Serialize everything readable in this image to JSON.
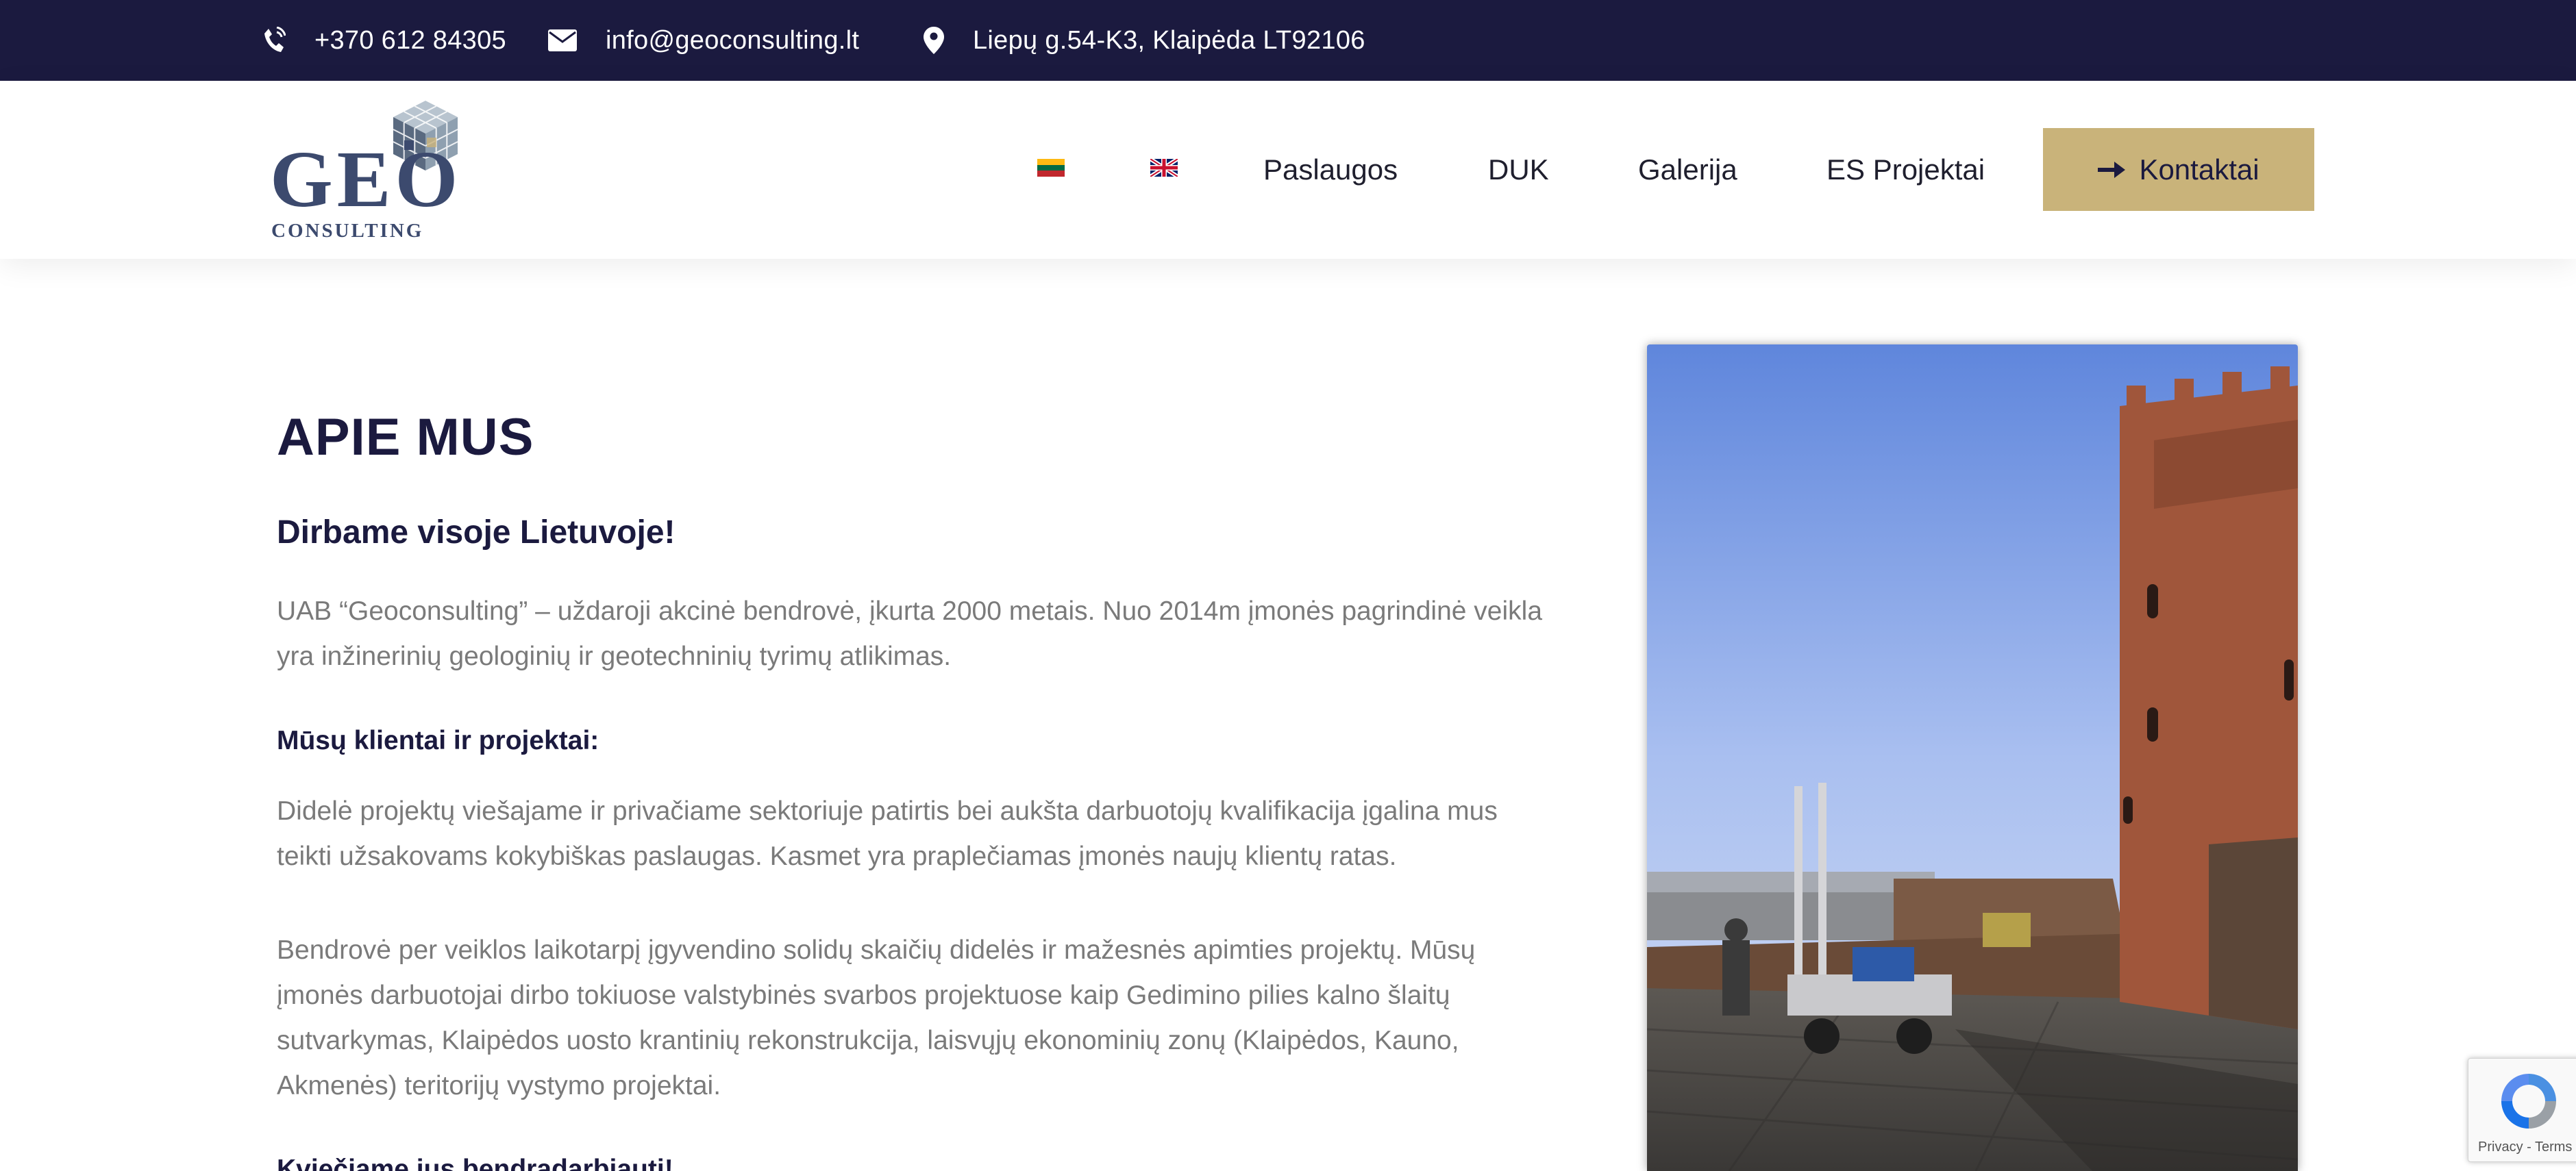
{
  "topbar": {
    "phone": "+370 612 84305",
    "email": "info@geoconsulting.lt",
    "address": "Liepų g.54-K3, Klaipėda LT92106",
    "icons": [
      "phone-icon",
      "envelope-icon",
      "map-pin-icon"
    ]
  },
  "logo": {
    "main": "GEO",
    "sub": "CONSULTING"
  },
  "nav": {
    "languages": [
      "lt-flag-icon",
      "en-flag-icon"
    ],
    "items": [
      {
        "label": "Paslaugos"
      },
      {
        "label": "DUK"
      },
      {
        "label": "Galerija"
      },
      {
        "label": "ES Projektai"
      }
    ],
    "cta_label": "Kontaktai"
  },
  "content": {
    "title": "APIE MUS",
    "subtitle": "Dirbame visoje Lietuvoje!",
    "intro": "UAB “Geoconsulting” – uždaroji akcinė bendrovė, įkurta 2000 metais. Nuo 2014m įmonės pagrindinė veikla yra inžinerinių geologinių ir geotechninių tyrimų atlikimas.",
    "clients_heading": "Mūsų klientai ir projektai:",
    "clients_text": "Didelė projektų viešajame ir privačiame sektoriuje patirtis bei aukšta darbuotojų kvalifikacija įgalina mus teikti užsakovams kokybiškas paslaugas. Kasmet yra praplečiamas įmonės naujų klientų ratas.",
    "projects_text": "Bendrovė per veiklos laikotarpį įgyvendino solidų skaičių didelės ir mažesnės apimties projektų. Mūsų įmonės darbuotojai dirbo tokiuose valstybinės svarbos projektuose kaip Gedimino pilies kalno šlaitų sutvarkymas, Klaipėdos uosto krantinių rekonstrukcija, laisvųjų ekonominių zonų (Klaipėdos, Kauno, Akmenės) teritorijų vystymo projektai.",
    "invite": "Kviečiame jus bendradarbiauti!"
  },
  "recaptcha": {
    "links": "Privacy - Terms"
  },
  "colors": {
    "topbar_bg": "#1b1a3f",
    "heading": "#1b1a3f",
    "body_text": "#7a7a7a",
    "cta_bg": "#c9b37a",
    "logo": "#3c4a6e"
  }
}
